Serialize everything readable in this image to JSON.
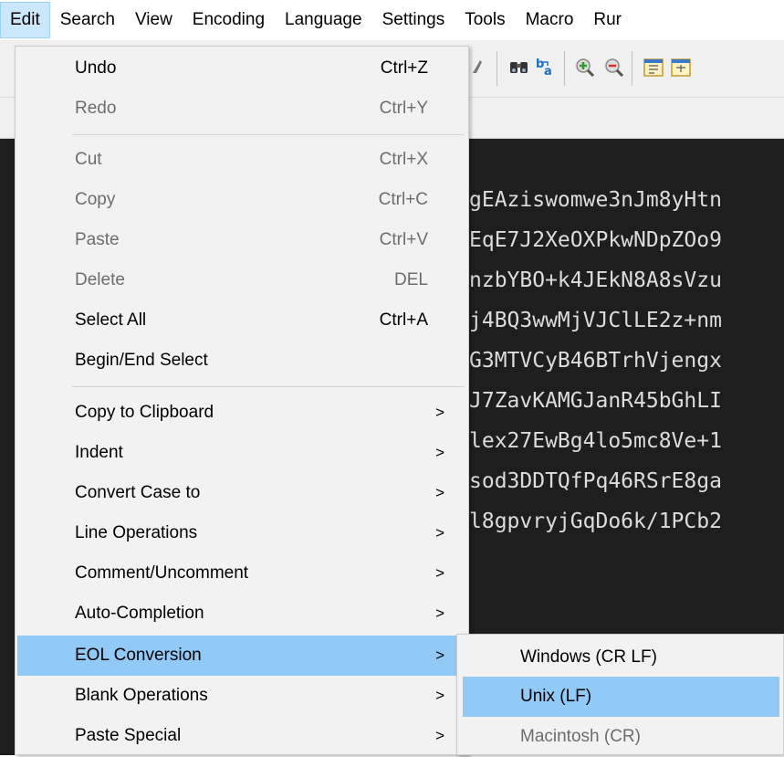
{
  "menubar": {
    "items": [
      {
        "label": "Edit"
      },
      {
        "label": "Search"
      },
      {
        "label": "View"
      },
      {
        "label": "Encoding"
      },
      {
        "label": "Language"
      },
      {
        "label": "Settings"
      },
      {
        "label": "Tools"
      },
      {
        "label": "Macro"
      },
      {
        "label": "Rur"
      }
    ]
  },
  "toolbar": {
    "icons": [
      "sort-icon",
      "find-binoculars-icon",
      "find-replace-icon",
      "zoom-in-icon",
      "zoom-out-icon",
      "sync-vertical-icon",
      "sync-horizontal-icon"
    ]
  },
  "editor": {
    "lines": [
      "gEAziswomwe3nJm8yHtn",
      "EqE7J2XeOXPkwNDpZOo9",
      "nzbYBO+k4JEkN8A8sVzu",
      "j4BQ3wwMjVJClLE2z+nm",
      "G3MTVCyB46BTrhVjengx",
      "J7ZavKAMGJanR45bGhLI",
      "lex27EwBg4lo5mc8Ve+1",
      "sod3DDTQfPq46RSrE8ga",
      "l8gpvryjGqDo6k/1PCb2"
    ],
    "background": "#1e1e1e"
  },
  "edit_menu": {
    "items": [
      {
        "label": "Undo",
        "shortcut": "Ctrl+Z"
      },
      {
        "label": "Redo",
        "shortcut": "Ctrl+Y"
      },
      {
        "label": "Cut",
        "shortcut": "Ctrl+X"
      },
      {
        "label": "Copy",
        "shortcut": "Ctrl+C"
      },
      {
        "label": "Paste",
        "shortcut": "Ctrl+V"
      },
      {
        "label": "Delete",
        "shortcut": "DEL"
      },
      {
        "label": "Select All",
        "shortcut": "Ctrl+A"
      },
      {
        "label": "Begin/End Select",
        "shortcut": ""
      },
      {
        "label": "Copy to Clipboard",
        "arrow": ">"
      },
      {
        "label": "Indent",
        "arrow": ">"
      },
      {
        "label": "Convert Case to",
        "arrow": ">"
      },
      {
        "label": "Line Operations",
        "arrow": ">"
      },
      {
        "label": "Comment/Uncomment",
        "arrow": ">"
      },
      {
        "label": "Auto-Completion",
        "arrow": ">"
      },
      {
        "label": "EOL Conversion",
        "arrow": ">"
      },
      {
        "label": "Blank Operations",
        "arrow": ">"
      },
      {
        "label": "Paste Special",
        "arrow": ">"
      }
    ]
  },
  "eol_submenu": {
    "items": [
      {
        "label": "Windows (CR LF)"
      },
      {
        "label": "Unix (LF)"
      },
      {
        "label": "Macintosh (CR)"
      }
    ]
  },
  "colors": {
    "menu_highlight": "#91c9f7",
    "menubar_active": "#cce8ff",
    "menu_background": "#f2f2f2",
    "disabled_text": "#6d6d6d"
  }
}
